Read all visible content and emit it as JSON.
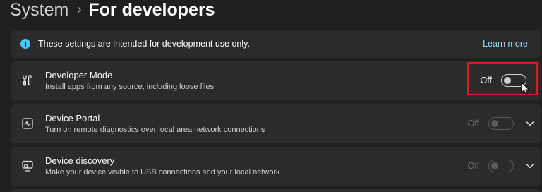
{
  "breadcrumb": {
    "parent": "System",
    "separator": "›",
    "current": "For developers"
  },
  "info": {
    "text": "These settings are intended for development use only.",
    "link": "Learn more"
  },
  "settings": [
    {
      "title": "Developer Mode",
      "description": "Install apps from any source, including loose files",
      "state": "Off",
      "enabled": true,
      "expandable": false
    },
    {
      "title": "Device Portal",
      "description": "Turn on remote diagnostics over local area network connections",
      "state": "Off",
      "enabled": false,
      "expandable": true
    },
    {
      "title": "Device discovery",
      "description": "Make your device visible to USB connections and your local network",
      "state": "Off",
      "enabled": false,
      "expandable": true
    }
  ],
  "icons": {
    "info": "info-icon",
    "developer_mode": "tools-icon",
    "device_portal": "pulse-monitor-icon",
    "device_discovery": "device-link-icon",
    "chevron": "chevron-down-icon",
    "cursor": "mouse-pointer-icon"
  },
  "colors": {
    "background": "#202020",
    "card": "#2b2b2b",
    "accent": "#4cc2ff",
    "link": "#99d9ff",
    "highlight": "#e0192a"
  }
}
